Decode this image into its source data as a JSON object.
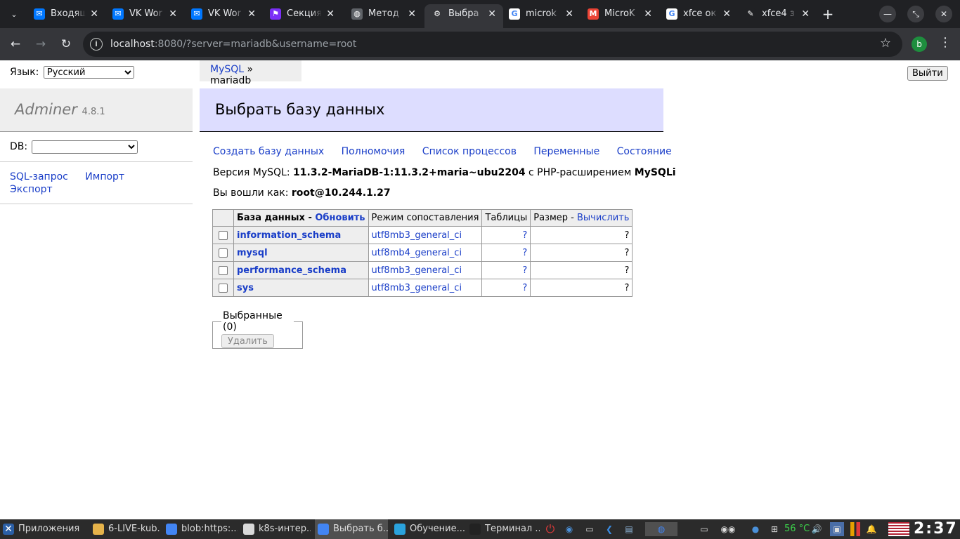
{
  "browser": {
    "tabs": [
      {
        "title": "Входящ",
        "icon": "mail-icon",
        "color": "#0077ff",
        "glyph": "✉"
      },
      {
        "title": "VK Wor",
        "icon": "vk-workspace-icon",
        "color": "#0077ff",
        "glyph": "✉"
      },
      {
        "title": "VK Wor",
        "icon": "vk-workspace-icon",
        "color": "#0077ff",
        "glyph": "✉"
      },
      {
        "title": "Секция",
        "icon": "section-icon",
        "color": "#7b2ff7",
        "glyph": "⚑"
      },
      {
        "title": "Метод",
        "icon": "globe-icon",
        "color": "#5f6368",
        "glyph": "◍"
      },
      {
        "title": "Выбра",
        "icon": "adminer-icon",
        "color": "#35363a",
        "glyph": "⚙"
      },
      {
        "title": "microk",
        "icon": "google-icon",
        "color": "#ffffff",
        "glyph": "G"
      },
      {
        "title": "MicroK",
        "icon": "gmail-icon",
        "color": "#ea4335",
        "glyph": "M"
      },
      {
        "title": "xfce ок",
        "icon": "google-icon",
        "color": "#ffffff",
        "glyph": "G"
      },
      {
        "title": "xfce4 з",
        "icon": "pen-icon",
        "color": "#202124",
        "glyph": "✎"
      }
    ],
    "active_tab": 5,
    "url_host": "localhost",
    "url_rest": ":8080/?server=mariadb&username=root",
    "profile_letter": "b"
  },
  "adminer": {
    "lang_label": "Язык:",
    "lang_selected": "Русский",
    "logout_label": "Выйти",
    "breadcrumb_link": "MySQL",
    "breadcrumb_sep": " » ",
    "breadcrumb_current": "mariadb",
    "brand_name": "Adminer",
    "brand_version": "4.8.1",
    "db_label": "DB:",
    "side_links": {
      "sql": "SQL-запрос",
      "import": "Импорт",
      "export": "Экспорт"
    },
    "page_title": "Выбрать базу данных",
    "links": {
      "create_db": "Создать базу данных",
      "privileges": "Полномочия",
      "processes": "Список процессов",
      "variables": "Переменные",
      "status": "Состояние"
    },
    "version_prefix": "Версия MySQL: ",
    "version_value": "11.3.2-MariaDB-1:11.3.2+maria~ubu2204",
    "version_mid": " с PHP-расширением ",
    "version_ext": "MySQLi",
    "logged_prefix": "Вы вошли как: ",
    "logged_value": "root@10.244.1.27",
    "table": {
      "h_db": "База данных",
      "h_dash": " - ",
      "h_refresh": "Обновить",
      "h_collation": "Режим сопоставления",
      "h_tables": "Таблицы",
      "h_size": "Размер",
      "h_compute": "Вычислить",
      "rows": [
        {
          "name": "information_schema",
          "collation": "utf8mb3_general_ci",
          "tables": "?",
          "size": "?"
        },
        {
          "name": "mysql",
          "collation": "utf8mb4_general_ci",
          "tables": "?",
          "size": "?"
        },
        {
          "name": "performance_schema",
          "collation": "utf8mb3_general_ci",
          "tables": "?",
          "size": "?"
        },
        {
          "name": "sys",
          "collation": "utf8mb3_general_ci",
          "tables": "?",
          "size": "?"
        }
      ]
    },
    "selected_legend": "Выбранные (0)",
    "delete_label": "Удалить"
  },
  "taskbar": {
    "apps_label": "Приложения",
    "items": [
      {
        "label": "6-LIVE-kub...",
        "icon": "folder-icon",
        "color": "#e6b34a"
      },
      {
        "label": "blob:https:...",
        "icon": "chrome-icon",
        "color": "#4285f4"
      },
      {
        "label": "k8s-интер...",
        "icon": "editor-icon",
        "color": "#d9d9d9"
      },
      {
        "label": "Выбрать б...",
        "icon": "chrome-icon",
        "color": "#4285f4"
      },
      {
        "label": "Обучение...",
        "icon": "telegram-icon",
        "color": "#2aa3dd"
      },
      {
        "label": "Терминал ...",
        "icon": "terminal-icon",
        "color": "#222222"
      }
    ],
    "temperature": "56 °C",
    "clock": "2:37"
  }
}
